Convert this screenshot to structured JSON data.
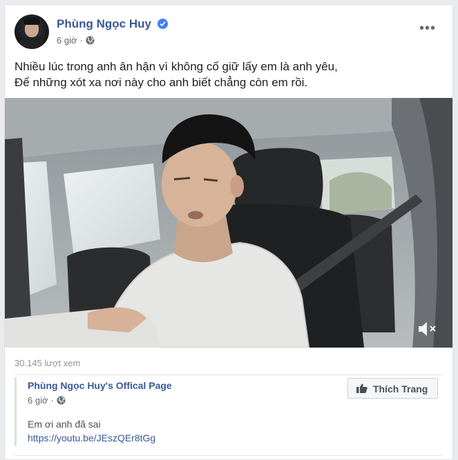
{
  "post": {
    "author": "Phùng Ngọc Huy",
    "time": "6 giờ",
    "separator": "·",
    "text_lines": [
      "Nhiều lúc trong anh ân hận vì không cố giữ lấy em là anh yêu,",
      "Để những xót xa nơi này cho anh biết chẳng còn em rồi."
    ],
    "views": "30.145 lượt xem"
  },
  "shared": {
    "page_name": "Phùng Ngọc Huy's Offical Page",
    "time": "6 giờ",
    "separator": "·",
    "message": "Em ơi anh đã sai",
    "link": "https://youtu.be/JEszQEr8tGg"
  },
  "buttons": {
    "like_page": "Thích Trang"
  },
  "icons": {
    "verified": "verified-badge-icon",
    "privacy": "globe-icon",
    "more": "more-options-icon",
    "mute": "speaker-muted-icon",
    "like": "thumbs-up-icon"
  },
  "colors": {
    "link": "#385898",
    "verified": "#4080ff",
    "secondary_text": "#606770"
  }
}
